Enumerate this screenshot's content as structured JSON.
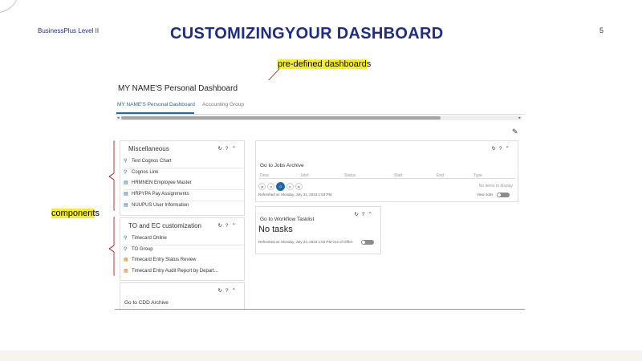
{
  "slide": {
    "header_left": "BusinessPlus Level II",
    "title": "CUSTOMIZINGYOUR  DASHBOARD",
    "page_number": "5",
    "callout_top": {
      "highlighted": "pre-defined dashboard",
      "rest": "s"
    },
    "callout_left": {
      "highlighted": "component",
      "rest": "s"
    }
  },
  "dashboard": {
    "title": "MY NAME'S Personal Dashboard",
    "tabs": [
      {
        "label": "MY NAME'S Personal Dashboard",
        "active": true
      },
      {
        "label": "Accounting Group",
        "active": false
      }
    ],
    "card_icons": [
      "refresh-icon",
      "help-icon",
      "collapse-icon"
    ],
    "cards": {
      "misc": {
        "title": "Miscellaneous",
        "items": [
          {
            "icon": "link-icon",
            "label": "Test Cognos Chart"
          },
          {
            "icon": "link-icon",
            "label": "Cognos Link"
          },
          {
            "icon": "screen-icon",
            "label": "HRMNEN Employee Master"
          },
          {
            "icon": "screen-icon",
            "label": "HRPYPA Pay Assignments"
          },
          {
            "icon": "screen-icon",
            "label": "NUUPUS User Information"
          }
        ]
      },
      "to": {
        "title": "TO and EC customization",
        "items": [
          {
            "icon": "link-icon",
            "label": "Timecard Online"
          },
          {
            "icon": "link-icon",
            "label": "TO Group"
          },
          {
            "icon": "report-icon",
            "label": "Timecard Entry Status Review"
          },
          {
            "icon": "report-icon",
            "label": "Timecard Entry Audit Report by Depart..."
          }
        ]
      },
      "cdd": {
        "title": "Go to CDD Archive"
      },
      "jobs": {
        "title": "Go to Jobs Archive",
        "columns": [
          "Desc",
          "Job#",
          "Status",
          "Start",
          "End",
          "Type"
        ],
        "no_data": "No items to display",
        "current_page": "0",
        "refreshed": "Refreshed at: Monday, July 24, 2023 1:03 PM",
        "toggle_label": "View Jobs"
      },
      "workflow": {
        "title": "Go to Workflow Tasklist",
        "no_tasks": "No tasks",
        "refreshed": "Refreshed at: Monday, July 24, 2023 1:03 PM",
        "toggle_label": "Out of Office"
      }
    }
  },
  "colors": {
    "title": "#1f2d86",
    "highlight": "#f7ee1c",
    "accent": "#1d6aa8",
    "callout_line": "#c00000"
  }
}
